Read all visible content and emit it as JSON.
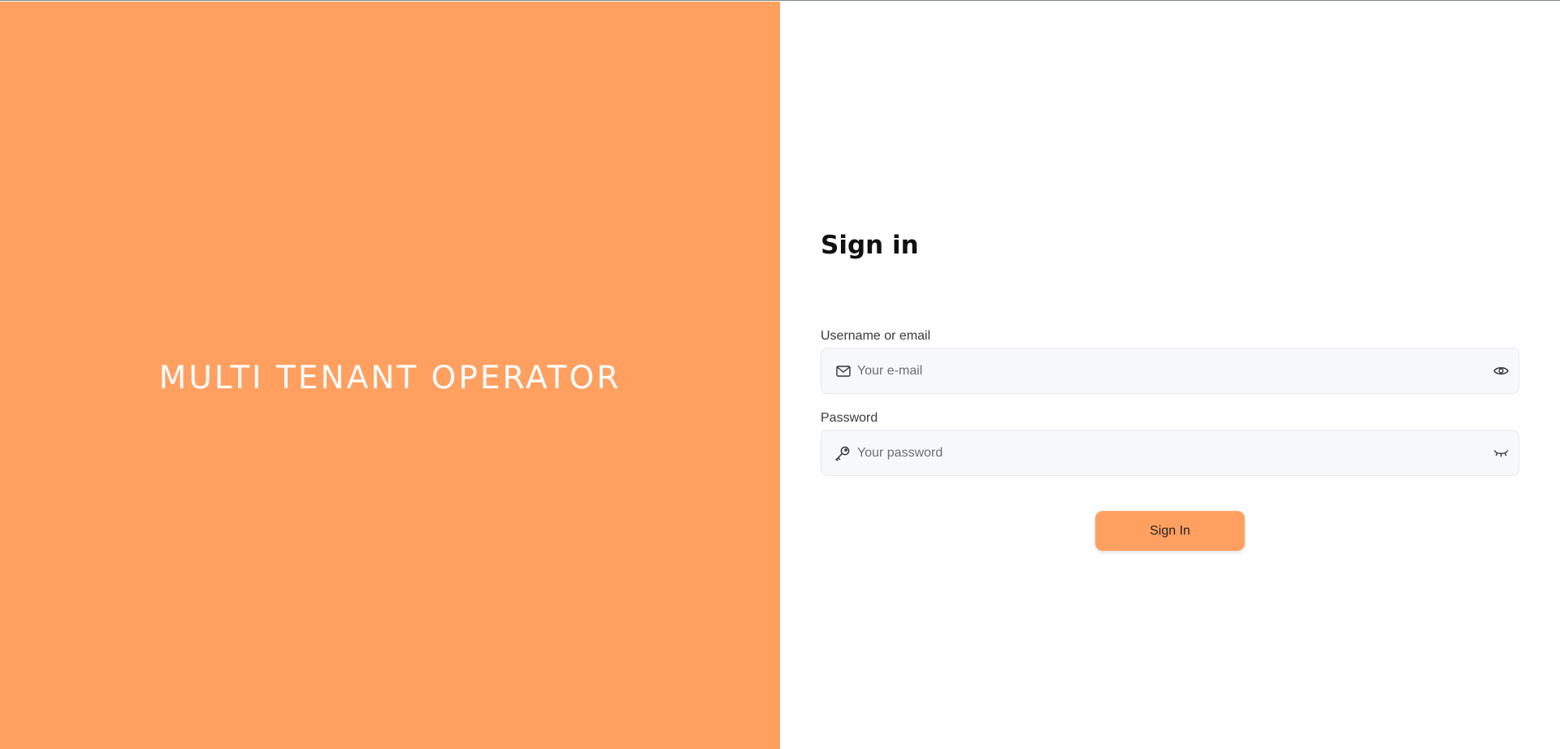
{
  "brand": {
    "title": "MULTI TENANT OPERATOR",
    "panel_color": "#ffa060"
  },
  "form": {
    "heading": "Sign in",
    "username": {
      "label": "Username or email",
      "placeholder": "Your e-mail",
      "value": "",
      "leading_icon": "mail-icon",
      "trailing_icon": "eye-icon"
    },
    "password": {
      "label": "Password",
      "placeholder": "Your password",
      "value": "",
      "leading_icon": "key-icon",
      "trailing_icon": "eye-closed-icon"
    },
    "submit_label": "Sign In",
    "accent_color": "#ffa060"
  }
}
